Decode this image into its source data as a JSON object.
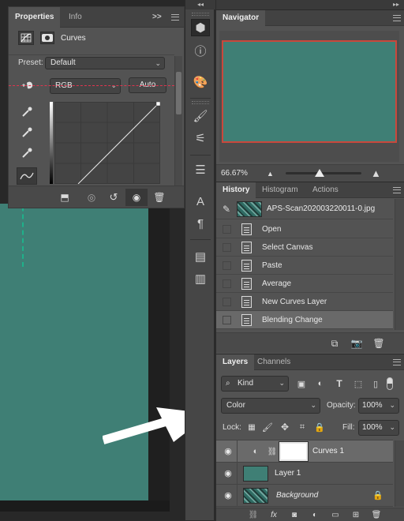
{
  "properties": {
    "tabs": [
      "Properties",
      "Info"
    ],
    "collapse_glyph": ">>",
    "adjustment_label": "Curves",
    "preset_label": "Preset:",
    "preset_value": "Default",
    "channel_value": "RGB",
    "auto_label": "Auto"
  },
  "navigator": {
    "title": "Navigator",
    "zoom": "66.67%",
    "zoom_slider_fraction": 0.45,
    "preview_color": "#3f7f75"
  },
  "history": {
    "tabs": [
      "History",
      "Histogram",
      "Actions"
    ],
    "snapshot_name": "APS-Scan202003220011-0.jpg",
    "states": [
      "Open",
      "Select Canvas",
      "Paste",
      "Average",
      "New Curves Layer",
      "Blending Change"
    ],
    "selected_state": "Blending Change"
  },
  "layers": {
    "tabs": [
      "Layers",
      "Channels"
    ],
    "filter_kind": "Kind",
    "blend_mode": "Color",
    "opacity_label": "Opacity:",
    "opacity_value": "100%",
    "lock_label": "Lock:",
    "fill_label": "Fill:",
    "fill_value": "100%",
    "items": [
      {
        "name": "Curves 1",
        "type": "adjustment",
        "selected": true
      },
      {
        "name": "Layer 1",
        "type": "fill",
        "color": "#3f7f75"
      },
      {
        "name": "Background",
        "type": "image",
        "locked": true
      }
    ]
  },
  "colors": {
    "panel_bg": "#535353",
    "doc_teal": "#3f7f75",
    "arrow": "#ffffff"
  }
}
